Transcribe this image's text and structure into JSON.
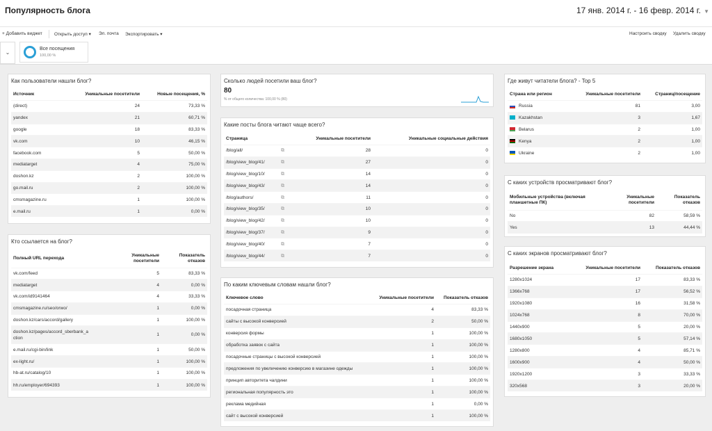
{
  "header": {
    "title": "Популярность блога",
    "date_range": "17 янв. 2014 г. - 16 февр. 2014 г."
  },
  "toolbar": {
    "add_widget": "+ Добавить виджет",
    "share": "Открыть доступ ▾",
    "email": "Эл. почта",
    "export": "Экспортировать ▾",
    "customize": "Настроить сводку",
    "delete": "Удалить сводку"
  },
  "segment": {
    "name": "Все посещения",
    "percent": "100,00 %"
  },
  "w_sources": {
    "title": "Как пользователи нашли блог?",
    "headers": [
      "Источник",
      "Уникальные посетители",
      "Новые посещения, %"
    ],
    "rows": [
      [
        "(direct)",
        "24",
        "73,33 %"
      ],
      [
        "yandex",
        "21",
        "60,71 %"
      ],
      [
        "google",
        "18",
        "83,33 %"
      ],
      [
        "vk.com",
        "10",
        "46,15 %"
      ],
      [
        "facebook.com",
        "5",
        "50,00 %"
      ],
      [
        "mediatarget",
        "4",
        "75,00 %"
      ],
      [
        "doshon.kz",
        "2",
        "100,00 %"
      ],
      [
        "go.mail.ru",
        "2",
        "100,00 %"
      ],
      [
        "cmsmagazine.ru",
        "1",
        "100,00 %"
      ],
      [
        "e.mail.ru",
        "1",
        "0,00 %"
      ]
    ]
  },
  "w_referrals": {
    "title": "Кто ссылается на блог?",
    "headers": [
      "Полный URL перехода",
      "Уникальные посетители",
      "Показатель отказов"
    ],
    "rows": [
      [
        "vk.com/feed",
        "5",
        "83,33 %"
      ],
      [
        "mediatarget",
        "4",
        "0,00 %"
      ],
      [
        "vk.com/id9141464",
        "4",
        "33,33 %"
      ],
      [
        "cmsmagazine.ru/seo/orwo/",
        "1",
        "0,00 %"
      ],
      [
        "doshon.kz/cars/accord/gallery",
        "1",
        "100,00 %"
      ],
      [
        "doshon.kz/pages/accord_sberbank_a",
        "ction",
        "1",
        "0,00 %"
      ],
      [
        "e.mail.ru/cgi-bin/link",
        "1",
        "50,00 %"
      ],
      [
        "ex-light.ru/",
        "1",
        "100,00 %"
      ],
      [
        "hb-at.ru/catalog/10",
        "1",
        "100,00 %"
      ],
      [
        "hh.ru/employer/694393",
        "1",
        "100,00 %"
      ]
    ]
  },
  "w_visitors": {
    "title": "Сколько людей посетили ваш блог?",
    "value": "80",
    "subtext": "% от общего количества: 100,00 % (80)"
  },
  "w_posts": {
    "title": "Какие посты блога читают чаще всего?",
    "headers": [
      "Страница",
      "Уникальные посетители",
      "Уникальные социальные действия"
    ],
    "rows": [
      [
        "/blog/all/",
        "28",
        "0"
      ],
      [
        "/blog/view_blog/41/",
        "27",
        "0"
      ],
      [
        "/blog/view_blog/10/",
        "14",
        "0"
      ],
      [
        "/blog/view_blog/43/",
        "14",
        "0"
      ],
      [
        "/blog/authors/",
        "11",
        "0"
      ],
      [
        "/blog/view_blog/35/",
        "10",
        "0"
      ],
      [
        "/blog/view_blog/42/",
        "10",
        "0"
      ],
      [
        "/blog/view_blog/37/",
        "9",
        "0"
      ],
      [
        "/blog/view_blog/40/",
        "7",
        "0"
      ],
      [
        "/blog/view_blog/44/",
        "7",
        "0"
      ]
    ]
  },
  "w_keywords": {
    "title": "По каким ключевым словам нашли блог?",
    "headers": [
      "Ключевое слово",
      "Уникальные посетители",
      "Показатель отказов"
    ],
    "rows": [
      [
        "посадочная страница",
        "4",
        "83,33 %"
      ],
      [
        "сайты с высокой конверсией",
        "2",
        "50,00 %"
      ],
      [
        "конверсия формы",
        "1",
        "100,00 %"
      ],
      [
        "обработка заявок с сайта",
        "1",
        "100,00 %"
      ],
      [
        "посадочные страницы с высокой конверсией",
        "1",
        "100,00 %"
      ],
      [
        "предложения по увеличению конверсию в магазине одежды",
        "1",
        "100,00 %"
      ],
      [
        "принцип авторитета чалдини",
        "1",
        "100,00 %"
      ],
      [
        "региональная популярность это",
        "1",
        "100,00 %"
      ],
      [
        "реклама медийная",
        "1",
        "0,00 %"
      ],
      [
        "сайт с высокой конверсией",
        "1",
        "100,00 %"
      ]
    ]
  },
  "w_countries": {
    "title": "Где живут читатели блога? - Top 5",
    "headers": [
      "Страна или регион",
      "Уникальные посетители",
      "Страниц/посещение"
    ],
    "rows": [
      [
        "Russia",
        "81",
        "3,00"
      ],
      [
        "Kazakhstan",
        "3",
        "1,67"
      ],
      [
        "Belarus",
        "2",
        "1,00"
      ],
      [
        "Kenya",
        "2",
        "1,00"
      ],
      [
        "Ukraine",
        "2",
        "1,00"
      ]
    ]
  },
  "w_devices": {
    "title": "С каких устройств просматривают блог?",
    "headers": [
      "Мобильные устройства (включая планшетные ПК)",
      "Уникальные посетители",
      "Показатель отказов"
    ],
    "rows": [
      [
        "No",
        "82",
        "58,59 %"
      ],
      [
        "Yes",
        "13",
        "44,44 %"
      ]
    ]
  },
  "w_screens": {
    "title": "С каких экранов просматривают блог?",
    "headers": [
      "Разрешение экрана",
      "Уникальные посетители",
      "Показатель отказов"
    ],
    "rows": [
      [
        "1280x1024",
        "17",
        "83,33 %"
      ],
      [
        "1366x768",
        "17",
        "56,52 %"
      ],
      [
        "1920x1080",
        "16",
        "31,58 %"
      ],
      [
        "1024x768",
        "8",
        "70,00 %"
      ],
      [
        "1440x900",
        "5",
        "20,00 %"
      ],
      [
        "1680x1050",
        "5",
        "57,14 %"
      ],
      [
        "1280x800",
        "4",
        "85,71 %"
      ],
      [
        "1600x900",
        "4",
        "50,00 %"
      ],
      [
        "1920x1200",
        "3",
        "33,33 %"
      ],
      [
        "320x568",
        "3",
        "20,00 %"
      ]
    ]
  }
}
